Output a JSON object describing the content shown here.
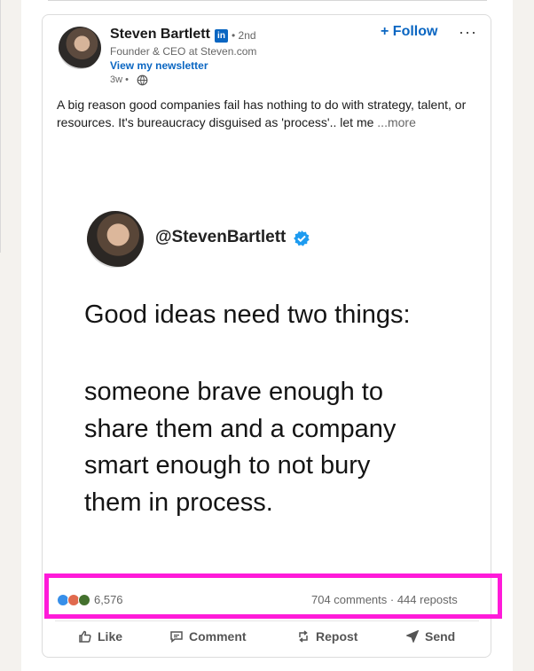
{
  "post": {
    "author": {
      "name": "Steven Bartlett",
      "badge": "in",
      "degree": "• 2nd",
      "headline": "Founder & CEO at Steven.com",
      "newsletter_link": "View my newsletter",
      "time": "3w •"
    },
    "follow_label": "+ Follow",
    "more_label": "···",
    "text": "A big reason good companies fail has nothing to do with strategy, talent, or resources. It's bureaucracy disguised as 'process'.. let me",
    "see_more": "...more",
    "image": {
      "handle": "@StevenBartlett",
      "line1": "Good ideas need two things:",
      "body_lines": [
        "someone brave enough to",
        "share them and a company",
        "smart enough to not bury",
        "them in process."
      ]
    },
    "stats": {
      "reactions": "6,576",
      "comments_reposts": "704 comments · 444 reposts"
    },
    "actions": {
      "like": "Like",
      "comment": "Comment",
      "repost": "Repost",
      "send": "Send"
    }
  },
  "colors": {
    "brand": "#0a66c2",
    "highlight": "#ff1ad9",
    "muted_text": "#666666"
  },
  "icons": [
    "linkedin-badge-icon",
    "globe-icon",
    "verified-icon",
    "like-icon",
    "comment-icon",
    "repost-icon",
    "send-icon"
  ]
}
